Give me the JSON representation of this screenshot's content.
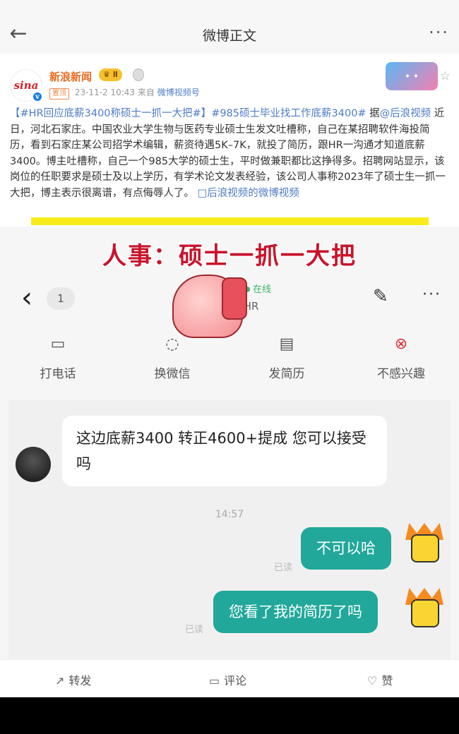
{
  "nav": {
    "title": "微博正文",
    "back_icon": "arrow-left-icon",
    "more_label": "···"
  },
  "post": {
    "author": "新浪新闻",
    "vip_badge": "Ⅱ",
    "avatar_text": "sina",
    "meta_tag": "置顶",
    "meta_time": "23-11-2 10:43",
    "meta_from": "来自",
    "meta_source": "微博视频号",
    "body_tag1": "【#HR回应底薪3400称硕士一抓一大把#】",
    "body_tag2": "#985硕士毕业找工作底薪3400#",
    "body_ju": " 据",
    "body_mention": "@后浪视频",
    "body_main": " 近日，河北石家庄。中国农业大学生物与医药专业硕士生发文吐槽称，自己在某招聘软件海投简历，看到石家庄某公司招学术编辑，薪资待遇5K–7K，就投了简历，跟HR一沟通才知道底薪3400。博主吐槽称，自己一个985大学的硕士生，平时做兼职都比这挣得多。招聘网站显示，该岗位的任职要求是硕士及以上学历，有学术论文发表经验，该公司人事称2023年了硕士生一抓一大把，博主表示很离谱，有点侮辱人了。",
    "video_link": "□后浪视频的微博视频"
  },
  "screenshot": {
    "headline": "人事：硕士一抓一大把",
    "unread": "1",
    "online": "在线",
    "hr_label": "·HR",
    "actions": [
      {
        "label": "打电话",
        "icon": "phone-icon"
      },
      {
        "label": "换微信",
        "icon": "wechat-icon"
      },
      {
        "label": "发简历",
        "icon": "resume-icon"
      },
      {
        "label": "不感兴趣",
        "icon": "not-interested-icon"
      }
    ],
    "msg_hr": "这边底薪3400  转正4600+提成  您可以接受吗",
    "time": "14:57",
    "msg_me1": "不可以哈",
    "msg_me2": "您看了我的简历了吗",
    "read_label": "已读"
  },
  "footer": {
    "repost": "转发",
    "comment": "评论",
    "like": "赞"
  }
}
